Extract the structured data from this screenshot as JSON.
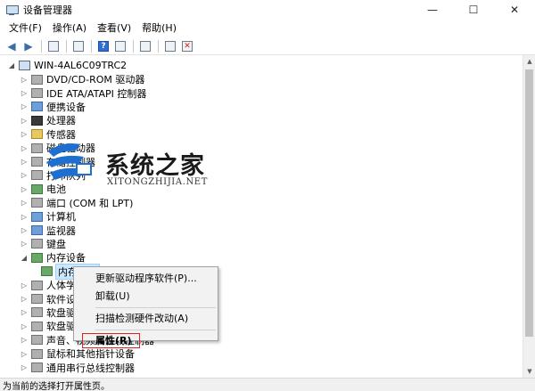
{
  "window": {
    "title": "设备管理器"
  },
  "controls": {
    "minimize": "—",
    "maximize": "☐",
    "close": "✕"
  },
  "menu": [
    "文件(F)",
    "操作(A)",
    "查看(V)",
    "帮助(H)"
  ],
  "tree": {
    "root": "WIN-4AL6C09TRC2",
    "items": [
      {
        "label": "DVD/CD-ROM 驱动器",
        "icon": "dvd-drive-icon",
        "expanded": false
      },
      {
        "label": "IDE ATA/ATAPI 控制器",
        "icon": "ide-controller-icon",
        "expanded": false
      },
      {
        "label": "便携设备",
        "icon": "portable-device-icon",
        "expanded": false
      },
      {
        "label": "处理器",
        "icon": "processor-icon",
        "expanded": false
      },
      {
        "label": "传感器",
        "icon": "sensor-icon",
        "expanded": false
      },
      {
        "label": "磁盘驱动器",
        "icon": "disk-drive-icon",
        "expanded": false
      },
      {
        "label": "存储控制器",
        "icon": "storage-controller-icon",
        "expanded": false
      },
      {
        "label": "打印队列",
        "icon": "printer-icon",
        "expanded": false
      },
      {
        "label": "电池",
        "icon": "battery-icon",
        "expanded": false
      },
      {
        "label": "端口 (COM 和 LPT)",
        "icon": "port-icon",
        "expanded": false
      },
      {
        "label": "计算机",
        "icon": "computer-icon",
        "expanded": false
      },
      {
        "label": "监视器",
        "icon": "monitor-icon",
        "expanded": false
      },
      {
        "label": "键盘",
        "icon": "keyboard-icon",
        "expanded": false
      },
      {
        "label": "内存设备",
        "icon": "memory-device-icon",
        "expanded": true
      },
      {
        "label": "内存设备",
        "icon": "memory-icon",
        "child": true,
        "selected": true
      },
      {
        "label": "人体学输入设备",
        "icon": "hid-icon",
        "expanded": false
      },
      {
        "label": "软件设备",
        "icon": "software-device-icon",
        "expanded": false
      },
      {
        "label": "软盘驱动器",
        "icon": "floppy-drive-icon",
        "expanded": false
      },
      {
        "label": "软盘驱动器控制器",
        "icon": "floppy-controller-icon",
        "expanded": false
      },
      {
        "label": "声音、视频和游戏控制器",
        "icon": "sound-icon",
        "expanded": false
      },
      {
        "label": "鼠标和其他指针设备",
        "icon": "mouse-icon",
        "expanded": false
      },
      {
        "label": "通用串行总线控制器",
        "icon": "usb-icon",
        "expanded": false
      }
    ]
  },
  "context_menu": {
    "items": [
      "更新驱动程序软件(P)...",
      "卸载(U)",
      "扫描检测硬件改动(A)",
      "属性(R)"
    ]
  },
  "watermark": {
    "title": "系统之家",
    "subtitle": "XITONGZHIJIA.NET"
  },
  "status": {
    "text": "为当前的选择打开属性页。"
  }
}
